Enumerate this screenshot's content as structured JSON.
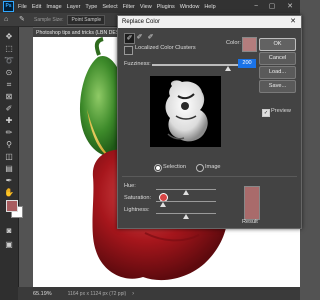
{
  "menu": {
    "app_icon": "Ps",
    "items": [
      "File",
      "Edit",
      "Image",
      "Layer",
      "Type",
      "Select",
      "Filter",
      "View",
      "Plugins",
      "Window",
      "Help"
    ],
    "min": "−",
    "max": "▢",
    "close": "✕"
  },
  "options": {
    "sample_size": "Sample Size:",
    "sample_value": "Point Sample"
  },
  "document": {
    "tab_title": "Photoshop tips and tricks (LBN DESIGN",
    "zoom": "65.19%",
    "info": "1164 px x 1124 px (72 ppi)"
  },
  "dialog": {
    "title": "Replace Color",
    "localized_label": "Localized Color Clusters",
    "color_label": "Color:",
    "fuzziness_label": "Fuzziness:",
    "fuzziness_value": "200",
    "fuzziness_fraction": 1.0,
    "selection_label": "Selection",
    "image_label": "Image",
    "hue_label": "Hue:",
    "saturation_label": "Saturation:",
    "lightness_label": "Lightness:",
    "result_label": "Result",
    "buttons": {
      "ok": "OK",
      "cancel": "Cancel",
      "load": "Load...",
      "save": "Save..."
    },
    "preview_label": "Preview",
    "colors": {
      "sampled": "#b37d7d",
      "result": "#a96b6b",
      "fuzz_value_bg": "#1a73e8"
    }
  },
  "colors": {
    "foreground": "#a85c5f",
    "background": "#ffffff"
  }
}
